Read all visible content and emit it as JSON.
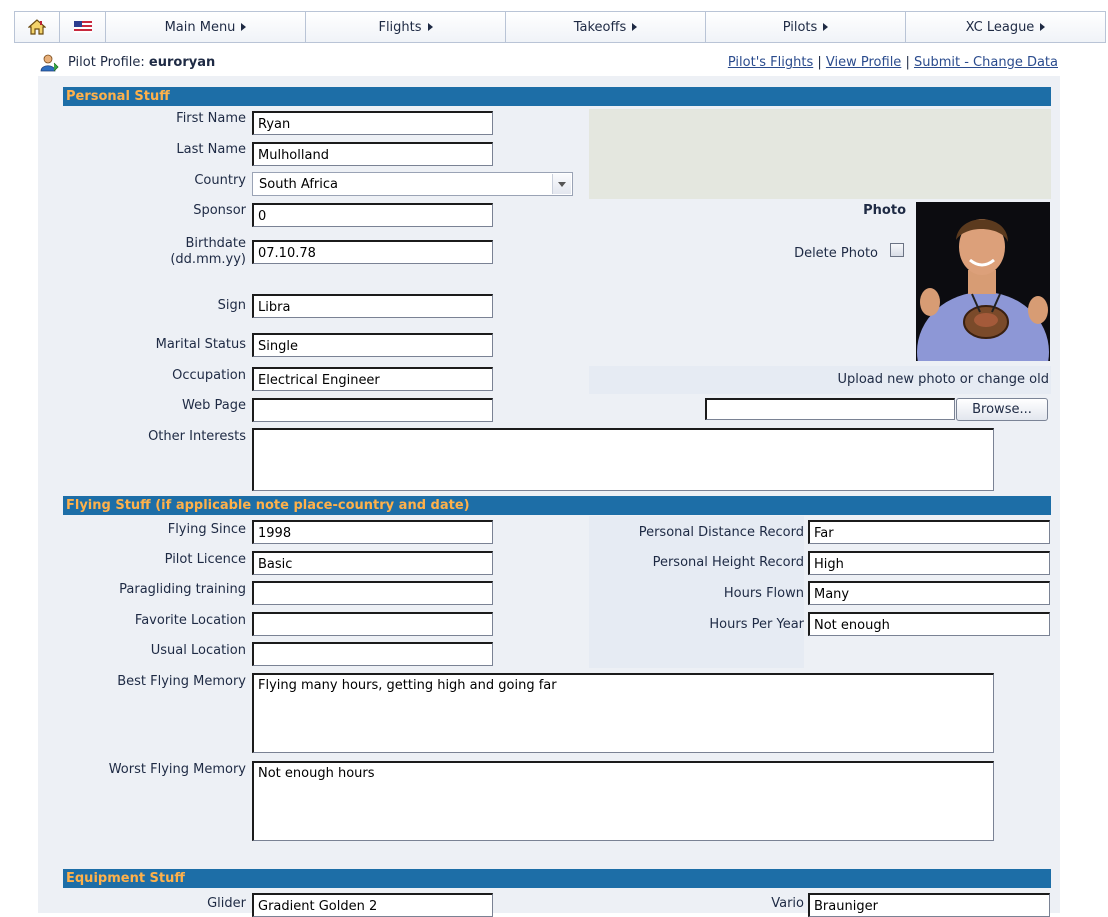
{
  "nav": {
    "items": [
      "Main Menu",
      "Flights",
      "Takeoffs",
      "Pilots",
      "XC League"
    ]
  },
  "profile": {
    "title_prefix": "Pilot Profile:",
    "username": "euroryan",
    "link_flights": "Pilot's Flights",
    "link_view": "View Profile",
    "link_submit": "Submit - Change Data",
    "separator": "|"
  },
  "personal": {
    "section_title": "Personal Stuff",
    "first_name_label": "First Name",
    "first_name": "Ryan",
    "last_name_label": "Last Name",
    "last_name": "Mulholland",
    "country_label": "Country",
    "country": "South Africa",
    "sponsor_label": "Sponsor",
    "sponsor": "0",
    "birthdate_label": "Birthdate",
    "birthdate_format": "(dd.mm.yy)",
    "birthdate": "07.10.78",
    "sign_label": "Sign",
    "sign": "Libra",
    "marital_label": "Marital Status",
    "marital": "Single",
    "occupation_label": "Occupation",
    "occupation": "Electrical Engineer",
    "webpage_label": "Web Page",
    "webpage": "",
    "interests_label": "Other Interests",
    "interests": "",
    "photo_label": "Photo",
    "delete_photo_label": "Delete Photo",
    "upload_label": "Upload new photo or change old",
    "browse_label": "Browse..."
  },
  "flying": {
    "section_title": "Flying Stuff (if applicable note place-country and date)",
    "since_label": "Flying Since",
    "since": "1998",
    "licence_label": "Pilot Licence",
    "licence": "Basic",
    "training_label": "Paragliding training",
    "training": "",
    "favorite_label": "Favorite Location",
    "favorite": "",
    "usual_label": "Usual Location",
    "usual": "",
    "best_label": "Best Flying Memory",
    "best": "Flying many hours, getting high and going far",
    "worst_label": "Worst Flying Memory",
    "worst": "Not enough hours",
    "distance_label": "Personal Distance Record",
    "distance": "Far",
    "height_label": "Personal Height Record",
    "height": "High",
    "hours_label": "Hours Flown",
    "hours": "Many",
    "per_year_label": "Hours Per Year",
    "per_year": "Not enough"
  },
  "equipment": {
    "section_title": "Equipment Stuff",
    "glider_label": "Glider",
    "glider": "Gradient Golden 2",
    "vario_label": "Vario",
    "vario": "Brauniger"
  }
}
